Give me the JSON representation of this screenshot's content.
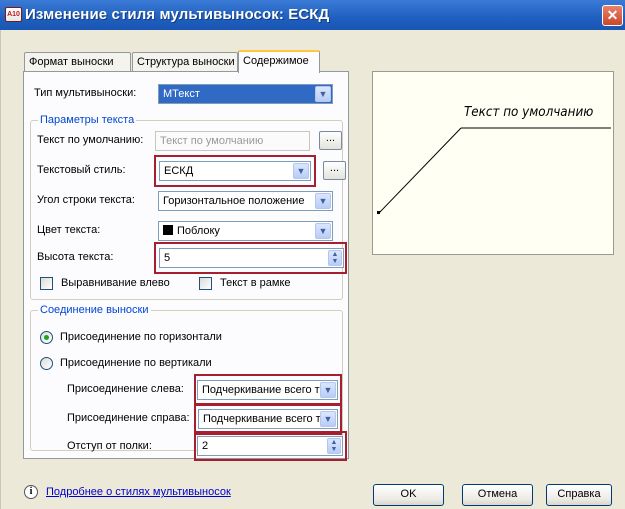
{
  "window": {
    "title": "Изменение стиля мультивыносок: ЕСКД",
    "app_icon_text": "A10",
    "close_glyph": "✕"
  },
  "tabs": [
    {
      "label": "Формат выноски",
      "active": false
    },
    {
      "label": "Структура выноски",
      "active": false
    },
    {
      "label": "Содержимое",
      "active": true
    }
  ],
  "content": {
    "type_label": "Тип мультивыноски:",
    "type_value": "MТекст",
    "text_params": {
      "title": "Параметры текста",
      "default_text_label": "Текст по умолчанию:",
      "default_text_value": "Текст по умолчанию",
      "text_style_label": "Текстовый стиль:",
      "text_style_value": "ЕСКД",
      "angle_label": "Угол строки текста:",
      "angle_value": "Горизонтальное положение",
      "color_label": "Цвет текста:",
      "color_value": "Поблоку",
      "height_label": "Высота текста:",
      "height_value": "5",
      "align_left_label": "Выравнивание влево",
      "frame_label": "Текст в рамке",
      "dots_label": "...",
      "color_swatch": "#000000"
    },
    "attachment": {
      "title": "Соединение выноски",
      "horizontal_label": "Присоединение по горизонтали",
      "vertical_label": "Присоединение по вертикали",
      "selected": "horizontal",
      "left_label": "Присоединение слева:",
      "left_value": "Подчеркивание всего т",
      "right_label": "Присоединение справа:",
      "right_value": "Подчеркивание всего т",
      "offset_label": "Отступ от полки:",
      "offset_value": "2"
    }
  },
  "preview": {
    "text": "Текст по умолчанию"
  },
  "footer": {
    "help_link": "Подробнее о стилях мультивыносок",
    "ok": "OK",
    "cancel": "Отмена",
    "help": "Справка"
  },
  "colors": {
    "highlight": "#a61f2e",
    "group_title": "#0046d5",
    "radio_dot": "#21a121"
  }
}
